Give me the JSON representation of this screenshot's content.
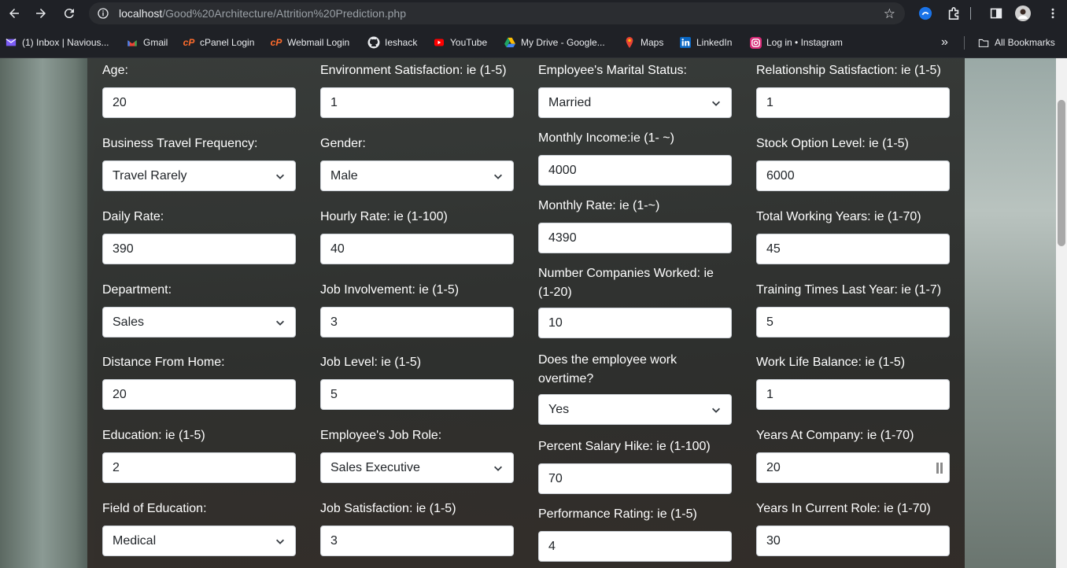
{
  "browser": {
    "url_host": "localhost",
    "url_path": "/Good%20Architecture/Attrition%20Prediction.php"
  },
  "bookmarks": {
    "items": [
      {
        "label": "(1) Inbox | Navious...",
        "icon": "mail-icon"
      },
      {
        "label": "Gmail",
        "icon": "gmail-icon"
      },
      {
        "label": "cPanel Login",
        "icon": "cpanel-icon"
      },
      {
        "label": "Webmail Login",
        "icon": "cpanel-icon"
      },
      {
        "label": "Ieshack",
        "icon": "github-icon"
      },
      {
        "label": "YouTube",
        "icon": "youtube-icon"
      },
      {
        "label": "My Drive - Google...",
        "icon": "drive-icon"
      },
      {
        "label": "Maps",
        "icon": "maps-icon"
      },
      {
        "label": "LinkedIn",
        "icon": "linkedin-icon"
      },
      {
        "label": "Log in • Instagram",
        "icon": "instagram-icon"
      }
    ],
    "overflow": "»",
    "all_bookmarks": "All Bookmarks"
  },
  "form": {
    "col1": [
      {
        "label": "Age:",
        "value": "20",
        "type": "input"
      },
      {
        "label": "Business Travel Frequency:",
        "value": "Travel Rarely",
        "type": "select"
      },
      {
        "label": "Daily Rate:",
        "value": "390",
        "type": "input"
      },
      {
        "label": "Department:",
        "value": "Sales",
        "type": "select"
      },
      {
        "label": "Distance From Home:",
        "value": "20",
        "type": "input"
      },
      {
        "label": "Education: ie (1-5)",
        "value": "2",
        "type": "input"
      },
      {
        "label": "Field of Education:",
        "value": "Medical",
        "type": "select"
      }
    ],
    "col2": [
      {
        "label": "Environment Satisfaction: ie (1-5)",
        "value": "1",
        "type": "input"
      },
      {
        "label": "Gender:",
        "value": "Male",
        "type": "select"
      },
      {
        "label": "Hourly Rate: ie (1-100)",
        "value": "40",
        "type": "input"
      },
      {
        "label": "Job Involvement: ie (1-5)",
        "value": "3",
        "type": "input"
      },
      {
        "label": "Job Level: ie (1-5)",
        "value": "5",
        "type": "input"
      },
      {
        "label": "Employee's Job Role:",
        "value": "Sales Executive",
        "type": "select"
      },
      {
        "label": "Job Satisfaction: ie (1-5)",
        "value": "3",
        "type": "input"
      }
    ],
    "col3": [
      {
        "label": "Employee's Marital Status:",
        "value": "Married",
        "type": "select"
      },
      {
        "label": "Monthly Income:ie (1- ~)",
        "value": "4000",
        "type": "input"
      },
      {
        "label": "Monthly Rate: ie (1-~)",
        "value": "4390",
        "type": "input"
      },
      {
        "label": "Number Companies Worked: ie (1-20)",
        "value": "10",
        "type": "input"
      },
      {
        "label": "Does the employee work overtime?",
        "value": "Yes",
        "type": "select"
      },
      {
        "label": "Percent Salary Hike: ie (1-100)",
        "value": "70",
        "type": "input"
      },
      {
        "label": "Performance Rating: ie (1-5)",
        "value": "4",
        "type": "input"
      }
    ],
    "col4": [
      {
        "label": "Relationship Satisfaction: ie (1-5)",
        "value": "1",
        "type": "input"
      },
      {
        "label": "Stock Option Level: ie (1-5)",
        "value": "6000",
        "type": "input"
      },
      {
        "label": "Total Working Years: ie (1-70)",
        "value": "45",
        "type": "input"
      },
      {
        "label": "Training Times Last Year: ie (1-7)",
        "value": "5",
        "type": "input"
      },
      {
        "label": "Work Life Balance: ie (1-5)",
        "value": "1",
        "type": "input"
      },
      {
        "label": "Years At Company: ie (1-70)",
        "value": "20",
        "type": "input"
      },
      {
        "label": "Years In Current Role: ie (1-70)",
        "value": "30",
        "type": "input"
      }
    ]
  }
}
